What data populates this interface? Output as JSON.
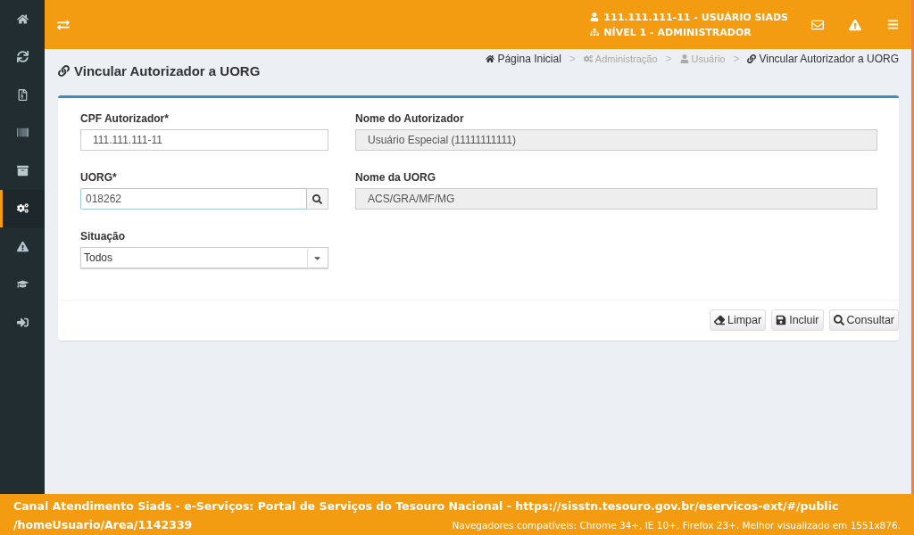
{
  "sidebar": {
    "items": [
      {
        "selected": false
      },
      {
        "selected": false
      },
      {
        "selected": false
      },
      {
        "selected": false
      },
      {
        "selected": false
      },
      {
        "selected": true
      },
      {
        "selected": false
      },
      {
        "selected": false
      },
      {
        "selected": false
      }
    ]
  },
  "header": {
    "user": "111.111.111-11 - USUÁRIO SIADS",
    "level": "NÍVEL 1 - ADMINISTRADOR"
  },
  "page_title": "Vincular Autorizador a UORG",
  "breadcrumb": [
    {
      "label": "Página Inicial",
      "disabled": false
    },
    {
      "label": "Administração",
      "disabled": true
    },
    {
      "label": "Usuário",
      "disabled": true
    },
    {
      "label": "Vincular Autorizador a UORG",
      "disabled": false
    }
  ],
  "breadcrumb_separator": ">",
  "form": {
    "cpf": {
      "label": "CPF Autorizador*",
      "value": "111.111.111-11"
    },
    "nome_autorizador": {
      "label": "Nome do Autorizador",
      "value": "Usuário Especial (11111111111)"
    },
    "uorg": {
      "label": "UORG*",
      "value": "018262"
    },
    "nome_uorg": {
      "label": "Nome da UORG",
      "value": "ACS/GRA/MF/MG"
    },
    "situacao": {
      "label": "Situação",
      "value": "Todos"
    }
  },
  "buttons": [
    "Limpar",
    "Incluir",
    "Consultar"
  ],
  "footer": {
    "lines": [
      "Canal Atendimento Siads - e-Serviços: Portal de Serviços do Tesouro Nacional - https://sisstn.tesouro.gov.br/eservicos-ext/#/public",
      "/homeUsuario/Area/1142339"
    ],
    "browsers": "Navegadores compatíveis: Chrome 34+, IE 10+, Firefox 23+. Melhor visualizado em 1551x876."
  }
}
